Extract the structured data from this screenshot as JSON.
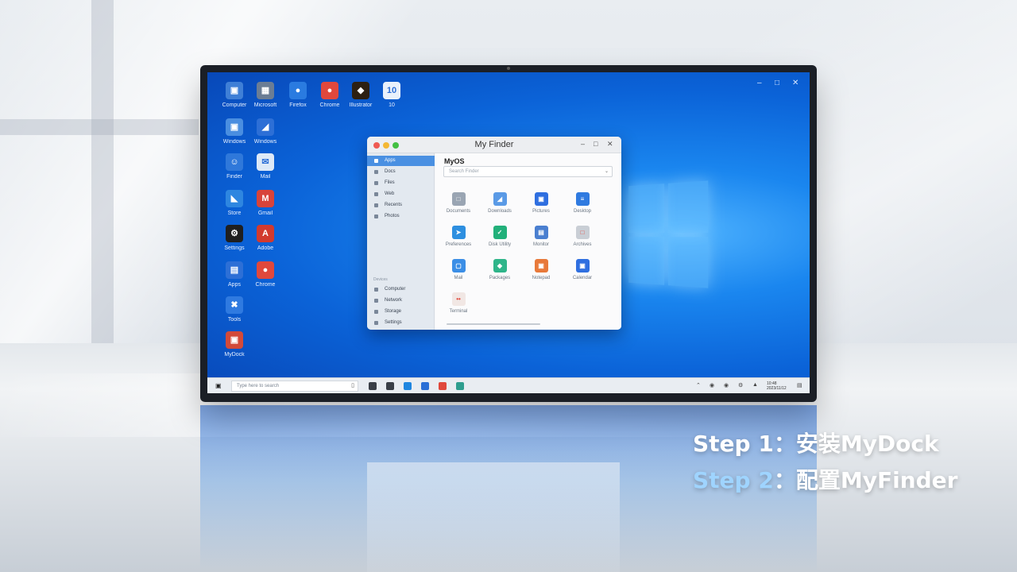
{
  "desktop": {
    "icons": [
      {
        "label": "Computer",
        "glyph": "▣",
        "color": "#3f7fd6"
      },
      {
        "label": "Microsoft",
        "glyph": "▦",
        "color": "#6b7d94"
      },
      {
        "label": "Firefox",
        "glyph": "●",
        "color": "#2a7be0"
      },
      {
        "label": "Chrome",
        "glyph": "●",
        "color": "#e0483c"
      },
      {
        "label": "Illustrator",
        "glyph": "◆",
        "color": "#2d2012"
      },
      {
        "label": "10",
        "glyph": "10",
        "color": "#e9f1fb"
      },
      {
        "label": "Windows",
        "glyph": "▣",
        "color": "#4a8ee0"
      },
      {
        "label": "Windows",
        "glyph": "◢",
        "color": "#2d6fd6"
      },
      {
        "label": "Finder",
        "glyph": "☺",
        "color": "#2f78da"
      },
      {
        "label": "Mail",
        "glyph": "✉",
        "color": "#dde9f7"
      },
      {
        "label": "Store",
        "glyph": "◣",
        "color": "#2e86e0"
      },
      {
        "label": "Gmail",
        "glyph": "M",
        "color": "#d8433a"
      },
      {
        "label": "Settings",
        "glyph": "⚙",
        "color": "#1f1f1f"
      },
      {
        "label": "Adobe",
        "glyph": "A",
        "color": "#d23a2e"
      },
      {
        "label": "Apps",
        "glyph": "▤",
        "color": "#2d6fd6"
      },
      {
        "label": "Chrome",
        "glyph": "●",
        "color": "#e0483c"
      },
      {
        "label": "Tools",
        "glyph": "✖",
        "color": "#2f7ae0"
      },
      {
        "label": "MyDock",
        "glyph": "▣",
        "color": "#d24a3a"
      }
    ]
  },
  "finder": {
    "title": "My Finder",
    "brand": "MyOS",
    "search_placeholder": "Search Finder",
    "sidebar": [
      {
        "label": "Apps",
        "active": true
      },
      {
        "label": "Docs",
        "active": false
      },
      {
        "label": "Files",
        "active": false
      },
      {
        "label": "Web",
        "active": false
      },
      {
        "label": "Recents",
        "active": false
      },
      {
        "label": "Photos",
        "active": false
      }
    ],
    "sidebar_section": "Devices",
    "sidebar_bottom": [
      {
        "label": "Computer"
      },
      {
        "label": "Network"
      },
      {
        "label": "Storage"
      },
      {
        "label": "Settings"
      }
    ],
    "apps": [
      {
        "label": "Documents",
        "glyph": "□",
        "color": "#9aa5b3"
      },
      {
        "label": "Downloads",
        "glyph": "◢",
        "color": "#5a9ae6"
      },
      {
        "label": "Pictures",
        "glyph": "▣",
        "color": "#2f6fe0"
      },
      {
        "label": "Desktop",
        "glyph": "≡",
        "color": "#2f7ae0"
      },
      {
        "label": "Preferences",
        "glyph": "➤",
        "color": "#2d8fe0"
      },
      {
        "label": "Disk Utility",
        "glyph": "✓",
        "color": "#22b07a"
      },
      {
        "label": "Monitor",
        "glyph": "▤",
        "color": "#4a7fd0"
      },
      {
        "label": "Archives",
        "glyph": "□",
        "color": "#c9ced5"
      },
      {
        "label": "Mail",
        "glyph": "▢",
        "color": "#3b8ee6"
      },
      {
        "label": "Packages",
        "glyph": "◆",
        "color": "#2fb58a"
      },
      {
        "label": "Notepad",
        "glyph": "▣",
        "color": "#e8793a"
      },
      {
        "label": "Calendar",
        "glyph": "▣",
        "color": "#2f6fe0"
      },
      {
        "label": "Terminal",
        "glyph": "••",
        "color": "#f1e7e4"
      }
    ]
  },
  "taskbar": {
    "search_placeholder": "Type here to search",
    "time": "10:48",
    "date": "2023/11/12",
    "apps": [
      {
        "name": "task-view-icon",
        "color": "#3a3f47"
      },
      {
        "name": "file-explorer-icon",
        "color": "#3a3f47"
      },
      {
        "name": "edge-icon",
        "color": "#1f86e0"
      },
      {
        "name": "store-icon",
        "color": "#2a6fd6"
      },
      {
        "name": "chrome-icon",
        "color": "#e0483c"
      },
      {
        "name": "finder-icon",
        "color": "#2f9e8f"
      }
    ]
  },
  "captions": {
    "step1": "Step 1：安装MyDock",
    "step2_prefix": "Step 2",
    "step2_rest": "：配置MyFinder",
    "step1_color": "#ffffff",
    "step2_prefix_color": "#9fd4ff",
    "step2_rest_color": "#ffffff"
  }
}
